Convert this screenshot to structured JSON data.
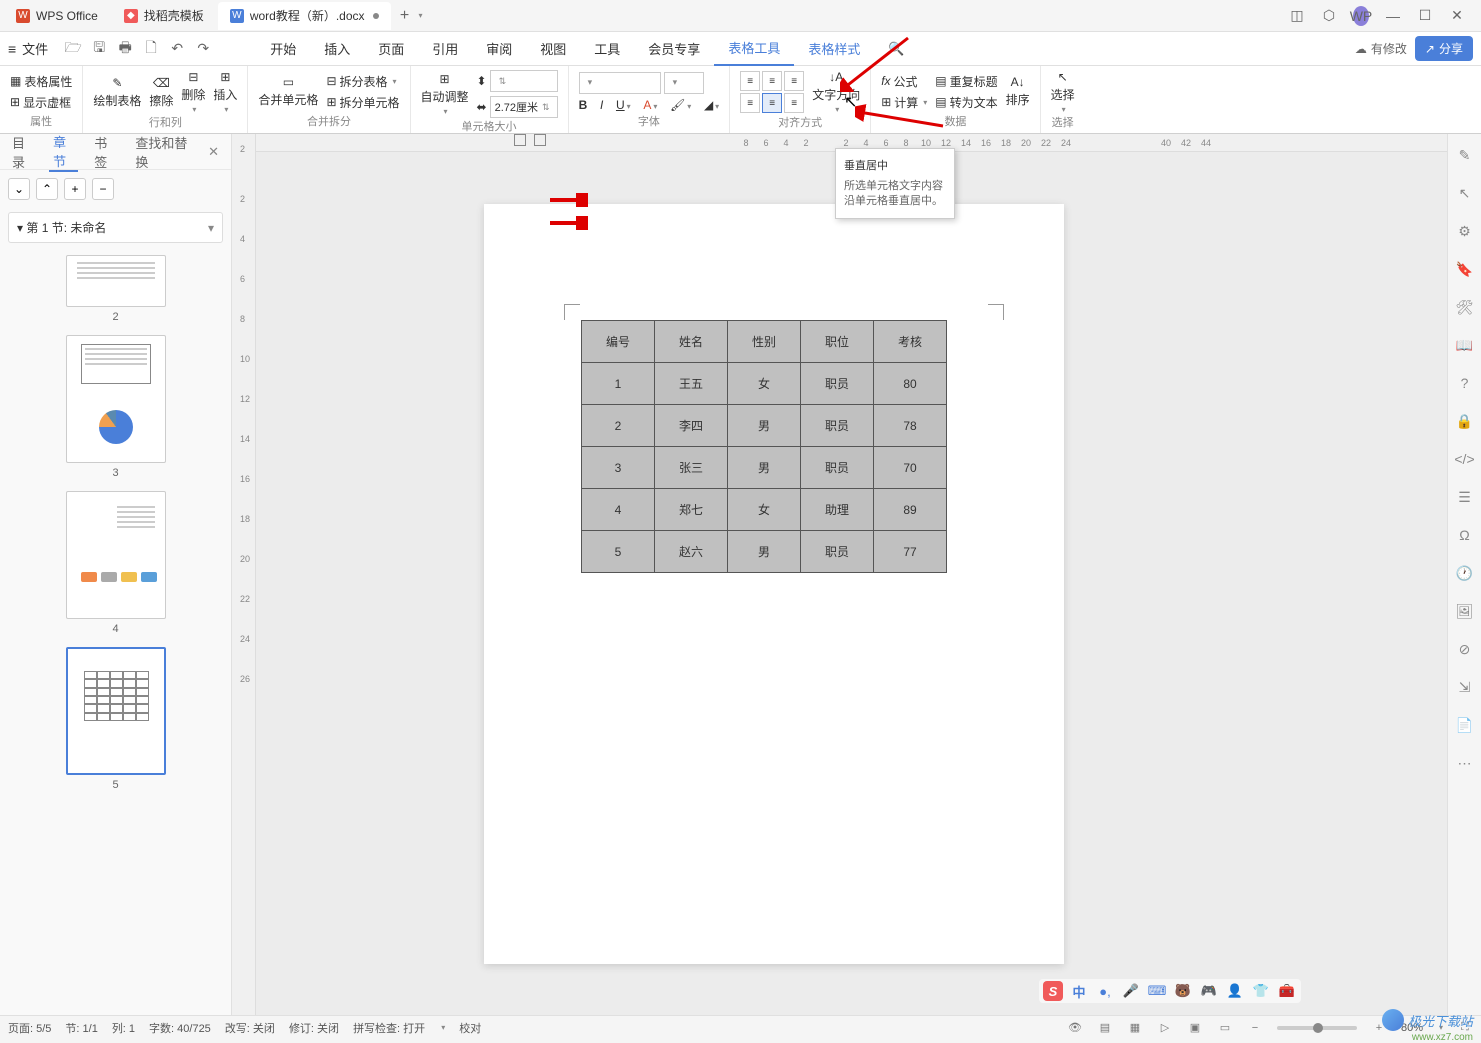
{
  "titlebar": {
    "tabs": [
      {
        "icon": "W",
        "label": "WPS Office"
      },
      {
        "icon": "D",
        "label": "找稻壳模板"
      },
      {
        "icon": "W",
        "label": "word教程（新）.docx"
      }
    ],
    "avatar": "WP"
  },
  "menubar": {
    "file": "文件",
    "items": [
      "开始",
      "插入",
      "页面",
      "引用",
      "审阅",
      "视图",
      "工具",
      "会员专享",
      "表格工具",
      "表格样式"
    ],
    "modify": "有修改",
    "share": "分享"
  },
  "ribbon": {
    "g1": {
      "prop": "表格属性",
      "frame": "显示虚框",
      "label": "属性"
    },
    "g2": {
      "draw": "绘制表格",
      "erase": "擦除",
      "del": "删除",
      "ins": "插入",
      "label": "行和列"
    },
    "g3": {
      "merge": "合并单元格",
      "split": "拆分表格",
      "splitcell": "拆分单元格",
      "label": "合并拆分"
    },
    "g4": {
      "auto": "自动调整",
      "hval": "",
      "wval": "2.72厘米",
      "label": "单元格大小"
    },
    "g5": {
      "font_name": "",
      "font_size": "",
      "label": "字体"
    },
    "g6": {
      "dir": "文字方向",
      "label": "对齐方式"
    },
    "g7": {
      "fx": "公式",
      "calc": "计算",
      "hdr": "重复标题",
      "conv": "转为文本",
      "sort": "排序",
      "label": "数据"
    },
    "g8": {
      "sel": "选择",
      "label": "选择"
    }
  },
  "tooltip": {
    "title": "垂直居中",
    "desc": "所选单元格文字内容沿单元格垂直居中。"
  },
  "nav": {
    "tabs": [
      "目录",
      "章节",
      "书签",
      "查找和替换"
    ],
    "section": "第 1 节: 未命名",
    "thumbs": [
      "2",
      "3",
      "4",
      "5"
    ]
  },
  "ruler_h": [
    "8",
    "6",
    "4",
    "2",
    "",
    "2",
    "4",
    "6",
    "8",
    "10",
    "12",
    "14",
    "16",
    "18",
    "20",
    "22",
    "24",
    "",
    "",
    "",
    "",
    "40",
    "42",
    "44"
  ],
  "ruler_v": [
    "2",
    "",
    "2",
    "4",
    "6",
    "8",
    "10",
    "12",
    "14",
    "16",
    "18",
    "20",
    "22",
    "24",
    "26",
    "",
    "",
    "",
    "",
    ""
  ],
  "table": {
    "headers": [
      "编号",
      "姓名",
      "性别",
      "职位",
      "考核"
    ],
    "rows": [
      [
        "1",
        "王五",
        "女",
        "职员",
        "80"
      ],
      [
        "2",
        "李四",
        "男",
        "职员",
        "78"
      ],
      [
        "3",
        "张三",
        "男",
        "职员",
        "70"
      ],
      [
        "4",
        "郑七",
        "女",
        "助理",
        "89"
      ],
      [
        "5",
        "赵六",
        "男",
        "职员",
        "77"
      ]
    ]
  },
  "statusbar": {
    "page": "页面: 5/5",
    "sec": "节: 1/1",
    "col": "列: 1",
    "words": "字数: 40/725",
    "rewrite": "改写: 关闭",
    "track": "修订: 关闭",
    "spell": "拼写检查: 打开",
    "proof": "校对",
    "zoom": "80%"
  }
}
